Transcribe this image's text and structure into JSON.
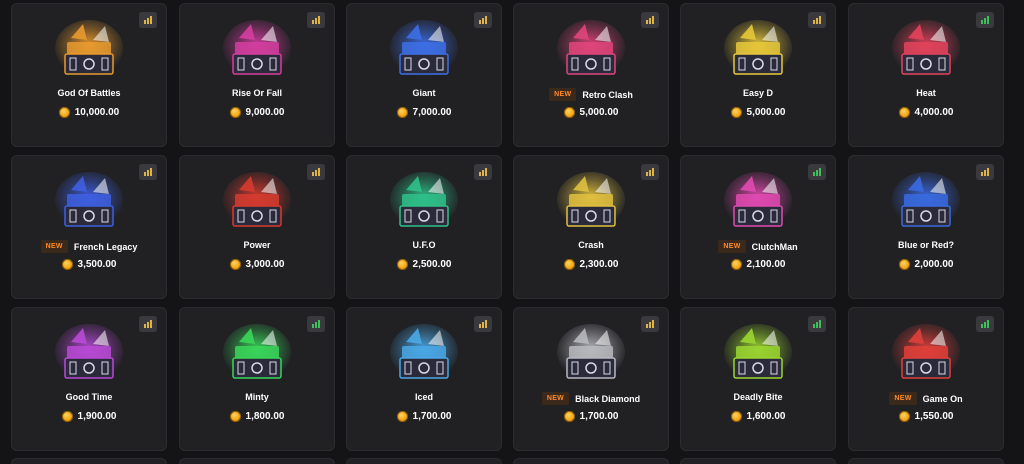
{
  "cases": [
    {
      "name": "God Of Battles",
      "price": "10,000.00",
      "is_new": false,
      "new_label": "",
      "color": "#e89a2e",
      "chart_color": "#e0b24a"
    },
    {
      "name": "Rise Or Fall",
      "price": "9,000.00",
      "is_new": false,
      "new_label": "",
      "color": "#d43ea0",
      "chart_color": "#e0b24a"
    },
    {
      "name": "Giant",
      "price": "7,000.00",
      "is_new": false,
      "new_label": "",
      "color": "#3d6ee6",
      "chart_color": "#e0b24a"
    },
    {
      "name": "Retro Clash",
      "price": "5,000.00",
      "is_new": true,
      "new_label": "NEW",
      "color": "#e0457a",
      "chart_color": "#e0b24a"
    },
    {
      "name": "Easy D",
      "price": "5,000.00",
      "is_new": false,
      "new_label": "",
      "color": "#e7c83a",
      "chart_color": "#e0b24a"
    },
    {
      "name": "Heat",
      "price": "4,000.00",
      "is_new": false,
      "new_label": "",
      "color": "#e2435c",
      "chart_color": "#3fbf5a"
    },
    {
      "name": "French Legacy",
      "price": "3,500.00",
      "is_new": true,
      "new_label": "NEW",
      "color": "#3e5fe0",
      "chart_color": "#e0b24a"
    },
    {
      "name": "Power",
      "price": "3,000.00",
      "is_new": false,
      "new_label": "",
      "color": "#d63b2f",
      "chart_color": "#e0b24a"
    },
    {
      "name": "U.F.O",
      "price": "2,500.00",
      "is_new": false,
      "new_label": "",
      "color": "#2fc08a",
      "chart_color": "#e0b24a"
    },
    {
      "name": "Crash",
      "price": "2,300.00",
      "is_new": false,
      "new_label": "",
      "color": "#e0c040",
      "chart_color": "#e0b24a"
    },
    {
      "name": "ClutchMan",
      "price": "2,100.00",
      "is_new": true,
      "new_label": "NEW",
      "color": "#e04ab0",
      "chart_color": "#3fbf5a"
    },
    {
      "name": "Blue or Red?",
      "price": "2,000.00",
      "is_new": false,
      "new_label": "",
      "color": "#3a6ae0",
      "chart_color": "#e0b24a"
    },
    {
      "name": "Good Time",
      "price": "1,900.00",
      "is_new": false,
      "new_label": "",
      "color": "#b84ad6",
      "chart_color": "#e0b24a"
    },
    {
      "name": "Minty",
      "price": "1,800.00",
      "is_new": false,
      "new_label": "",
      "color": "#3ad65a",
      "chart_color": "#3fbf5a"
    },
    {
      "name": "Iced",
      "price": "1,700.00",
      "is_new": false,
      "new_label": "",
      "color": "#4aa8e6",
      "chart_color": "#e0b24a"
    },
    {
      "name": "Black Diamond",
      "price": "1,700.00",
      "is_new": true,
      "new_label": "NEW",
      "color": "#b8b8c0",
      "chart_color": "#e0b24a"
    },
    {
      "name": "Deadly Bite",
      "price": "1,600.00",
      "is_new": false,
      "new_label": "",
      "color": "#9ad630",
      "chart_color": "#3fbf5a"
    },
    {
      "name": "Game On",
      "price": "1,550.00",
      "is_new": true,
      "new_label": "NEW",
      "color": "#e0403a",
      "chart_color": "#3fbf5a"
    }
  ],
  "icons": {
    "stats": "stats-icon",
    "coin": "coin-icon"
  }
}
